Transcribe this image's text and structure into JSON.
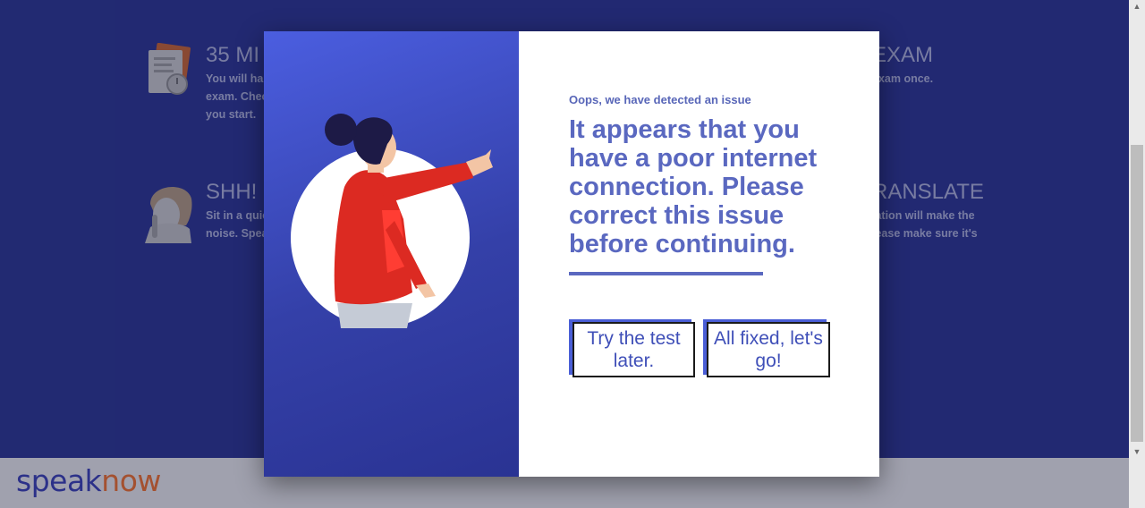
{
  "background": {
    "items": [
      {
        "title": "35 MI",
        "text_lines": [
          "You will ha",
          "exam. Chec",
          "you start."
        ],
        "icon": "document-clock-icon"
      },
      {
        "title": "EXAM",
        "text_lines": [
          "exam once."
        ]
      },
      {
        "title": "SHH!",
        "text_lines": [
          "Sit in a quie",
          "noise. Spea"
        ],
        "icon": "shush-person-icon"
      },
      {
        "title": "RANSLATE",
        "text_lines": [
          "lation will make the",
          "lease make sure it's"
        ]
      }
    ]
  },
  "footer": {
    "logo_part1": "speak",
    "logo_part2": "now"
  },
  "modal": {
    "eyebrow": "Oops, we have detected an issue",
    "headline": "It appears that you have a poor internet connection. Please correct this issue before continuing.",
    "buttons": {
      "later": "Try the test later.",
      "fixed": "All fixed, let's go!"
    },
    "illustration": "woman-pointing-illustration"
  },
  "colors": {
    "accent": "#5a68c0",
    "button_shadow": "#4a5ed6",
    "panel_gradient_start": "#4b5ee0",
    "panel_gradient_end": "#2a3393",
    "page_background": "#2a338f",
    "logo_blue": "#3a3fb3",
    "logo_orange": "#f2702a"
  }
}
